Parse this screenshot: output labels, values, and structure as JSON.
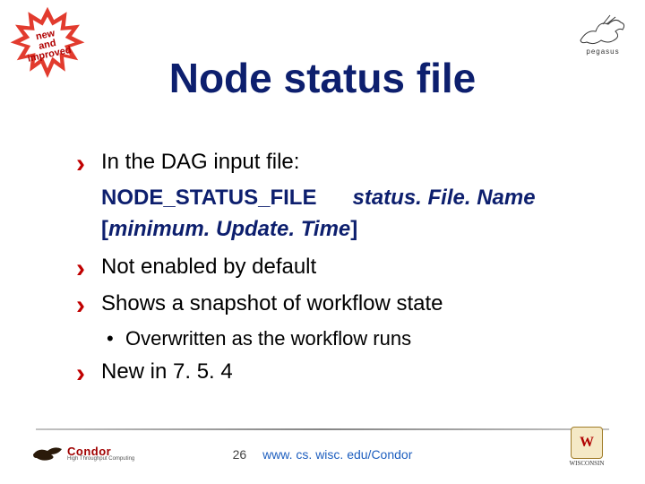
{
  "badge": {
    "line1": "new",
    "line2": "and",
    "line3": "improved"
  },
  "pegasus_label": "pegasus",
  "title": "Node status file",
  "bullets": {
    "b1": "In the DAG input file:",
    "code1_a": "NODE_STATUS_FILE",
    "code1_b": "status. File. Name",
    "code2_a": "[",
    "code2_b": "minimum. Update. Time",
    "code2_c": "]",
    "b2": "Not enabled by default",
    "b3": "Shows a snapshot of workflow state",
    "sub1": "Overwritten as the workflow runs",
    "b4": "New in 7. 5. 4"
  },
  "footer": {
    "page": "26",
    "url": "www. cs. wisc. edu/Condor"
  },
  "condor": {
    "name": "Condor",
    "sub": "High Throughput Computing"
  },
  "wisc": {
    "line1": "WISCONSIN"
  }
}
